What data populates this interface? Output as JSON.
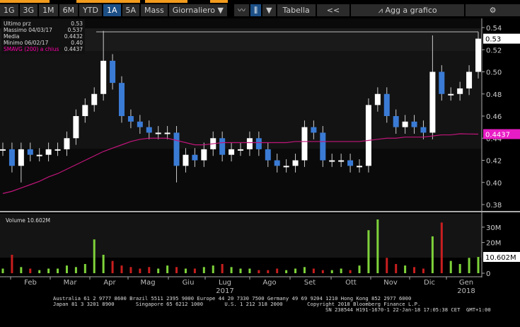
{
  "toolbar": {
    "periods": [
      "1G",
      "3G",
      "1M",
      "6M",
      "YTD",
      "1A",
      "5A"
    ],
    "active_period": "1A",
    "mass": "Mass",
    "frequency": "Giornaliero",
    "table": "Tabella",
    "collapse": "<<",
    "add_to_chart": "Agg a grafico"
  },
  "legend": {
    "rows": [
      {
        "label": "Ultimo prz",
        "value": "0.53"
      },
      {
        "label": "Massimo 04/03/17",
        "value": "0.537"
      },
      {
        "label": "Media",
        "value": "0.4432"
      },
      {
        "label": "Minimo 06/02/17",
        "value": "0.40"
      },
      {
        "label": "SMAVG (200) a chius",
        "value": "0.4437"
      }
    ],
    "volume_label": "Volume",
    "volume_value": "10.602M"
  },
  "colors": {
    "up": "#ffffff",
    "down": "#3a7bd5",
    "smavg": "#c0157a",
    "vol_up": "#7ed33a",
    "vol_down": "#c81e1e",
    "last_tag": "#e81cc4"
  },
  "chart_data": {
    "type": "candlestick",
    "price_axis": {
      "ticks": [
        "0.54",
        "0.52",
        "0.50",
        "0.48",
        "0.46",
        "0.44",
        "0.42",
        "0.40",
        "0.38"
      ],
      "ylim": [
        0.375,
        0.545
      ],
      "last_price_tag": "0.53",
      "smavg_tag": "0.4437"
    },
    "volume_axis": {
      "ticks": [
        "30M",
        "20M",
        "0"
      ],
      "ylim": [
        0,
        37
      ],
      "last_tag": "10.602M"
    },
    "months": [
      "Feb",
      "Mar",
      "Apr",
      "Mag",
      "Giu",
      "Lug",
      "Ago",
      "Set",
      "Ott",
      "Nov",
      "Dic",
      "Gen"
    ],
    "years": [
      "2017",
      "2018"
    ],
    "start_date": "2017-01-23",
    "interval": "weekly (approx.)",
    "close": [
      0.43,
      0.415,
      0.43,
      0.425,
      0.425,
      0.43,
      0.43,
      0.44,
      0.46,
      0.47,
      0.48,
      0.51,
      0.49,
      0.46,
      0.455,
      0.45,
      0.445,
      0.445,
      0.445,
      0.415,
      0.425,
      0.42,
      0.43,
      0.44,
      0.425,
      0.43,
      0.43,
      0.44,
      0.43,
      0.42,
      0.415,
      0.415,
      0.42,
      0.45,
      0.445,
      0.42,
      0.42,
      0.42,
      0.415,
      0.415,
      0.47,
      0.48,
      0.46,
      0.45,
      0.455,
      0.45,
      0.445,
      0.5,
      0.48,
      0.48,
      0.485,
      0.5,
      0.53
    ],
    "high_overrides": {
      "11": 0.537,
      "47": 0.533
    },
    "low_overrides": {
      "2": 0.4,
      "19": 0.4
    },
    "smavg200": [
      0.39,
      0.392,
      0.395,
      0.398,
      0.401,
      0.405,
      0.408,
      0.412,
      0.416,
      0.42,
      0.424,
      0.428,
      0.431,
      0.434,
      0.437,
      0.439,
      0.44,
      0.44,
      0.44,
      0.438,
      0.436,
      0.434,
      0.434,
      0.435,
      0.436,
      0.436,
      0.436,
      0.436,
      0.436,
      0.436,
      0.436,
      0.436,
      0.437,
      0.437,
      0.437,
      0.437,
      0.437,
      0.437,
      0.437,
      0.437,
      0.438,
      0.439,
      0.44,
      0.44,
      0.441,
      0.441,
      0.441,
      0.442,
      0.443,
      0.443,
      0.444,
      0.4438,
      0.4437
    ],
    "volume_m": [
      3,
      12,
      4,
      3,
      2,
      3,
      3,
      5,
      4,
      6,
      22,
      12,
      8,
      5,
      4,
      3,
      4,
      3,
      5,
      4,
      3,
      3,
      4,
      5,
      6,
      4,
      3,
      3,
      2,
      2,
      3,
      2,
      3,
      4,
      3,
      2,
      2,
      3,
      2,
      5,
      28,
      35,
      10,
      6,
      5,
      4,
      3,
      24,
      33,
      8,
      6,
      10,
      10.602
    ]
  },
  "footer": {
    "line1": "Australia 61 2 9777 8600 Brazil 5511 2395 9000 Europe 44 20 7330 7500 Germany 49 69 9204 1210 Hong Kong 852 2977 6000",
    "line2": "Japan 81 3 3201 8900       Singapore 65 6212 1000       U.S. 1 212 318 2000        Copyright 2018 Bloomberg Finance L.P.",
    "line3": "SN 238544 H191-1670-1 22-Jan-18 17:05:38 CET  GMT+1:00"
  }
}
